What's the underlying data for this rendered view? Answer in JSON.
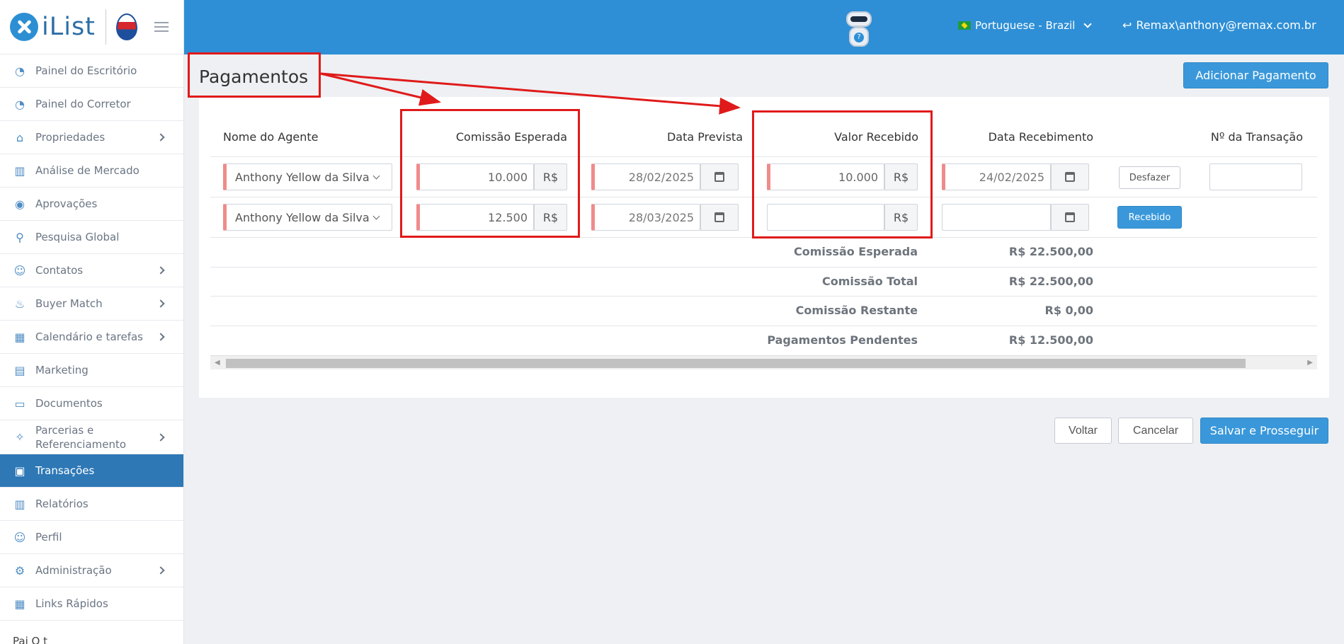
{
  "app": {
    "logo_text": "iList",
    "partner_logo": "RE/MAX"
  },
  "sidebar": {
    "items": [
      {
        "label": "Painel do Escritório",
        "icon": "gauge-icon",
        "chevron": false
      },
      {
        "label": "Painel do Corretor",
        "icon": "gauge-icon",
        "chevron": false
      },
      {
        "label": "Propriedades",
        "icon": "home-icon",
        "chevron": true
      },
      {
        "label": "Análise de Mercado",
        "icon": "bar-chart-icon",
        "chevron": false
      },
      {
        "label": "Aprovações",
        "icon": "eye-icon",
        "chevron": false
      },
      {
        "label": "Pesquisa Global",
        "icon": "search-icon",
        "chevron": false
      },
      {
        "label": "Contatos",
        "icon": "contacts-icon",
        "chevron": true
      },
      {
        "label": "Buyer Match",
        "icon": "fire-icon",
        "chevron": true
      },
      {
        "label": "Calendário e tarefas",
        "icon": "calendar-icon",
        "chevron": true
      },
      {
        "label": "Marketing",
        "icon": "book-icon",
        "chevron": false
      },
      {
        "label": "Documentos",
        "icon": "folder-icon",
        "chevron": false
      },
      {
        "label": "Parcerias e Referenciamento",
        "icon": "handshake-icon",
        "chevron": true
      },
      {
        "label": "Transações",
        "icon": "briefcase-icon",
        "chevron": false,
        "active": true
      },
      {
        "label": "Relatórios",
        "icon": "bar-chart-icon",
        "chevron": false
      },
      {
        "label": "Perfil",
        "icon": "user-icon",
        "chevron": false
      },
      {
        "label": "Administração",
        "icon": "gear-icon",
        "chevron": true
      },
      {
        "label": "Links Rápidos",
        "icon": "building-icon",
        "chevron": false
      }
    ],
    "cut_off_text": "Pai              O    t"
  },
  "topbar": {
    "language": "Portuguese - Brazil",
    "user": "Remax\\anthony@remax.com.br"
  },
  "page": {
    "title": "Pagamentos",
    "add_button": "Adicionar Pagamento"
  },
  "table": {
    "headers": {
      "agent": "Nome do Agente",
      "expected": "Comissão Esperada",
      "due_date": "Data Prevista",
      "received_value": "Valor Recebido",
      "received_date": "Data Recebimento",
      "transaction_no": "Nº da Transação"
    },
    "currency": "R$",
    "rows": [
      {
        "agent": "Anthony Yellow da Silva",
        "expected": "10.000",
        "due_date": "28/02/2025",
        "received_value": "10.000",
        "received_date": "24/02/2025",
        "action": "Desfazer"
      },
      {
        "agent": "Anthony Yellow da Silva",
        "expected": "12.500",
        "due_date": "28/03/2025",
        "received_value": "",
        "received_date": "",
        "action": "Recebido"
      }
    ],
    "summary": [
      {
        "label": "Comissão Esperada",
        "value": "R$ 22.500,00"
      },
      {
        "label": "Comissão Total",
        "value": "R$ 22.500,00"
      },
      {
        "label": "Comissão Restante",
        "value": "R$ 0,00"
      },
      {
        "label": "Pagamentos Pendentes",
        "value": "R$ 12.500,00"
      }
    ]
  },
  "footer": {
    "back": "Voltar",
    "cancel": "Cancelar",
    "save": "Salvar e Prosseguir"
  },
  "colors": {
    "topbar": "#2e8fd6",
    "active_nav": "#2e78b6",
    "primary_button": "#3a98da",
    "required_marker": "#f08b8b",
    "annotation": "#e01a1a"
  }
}
